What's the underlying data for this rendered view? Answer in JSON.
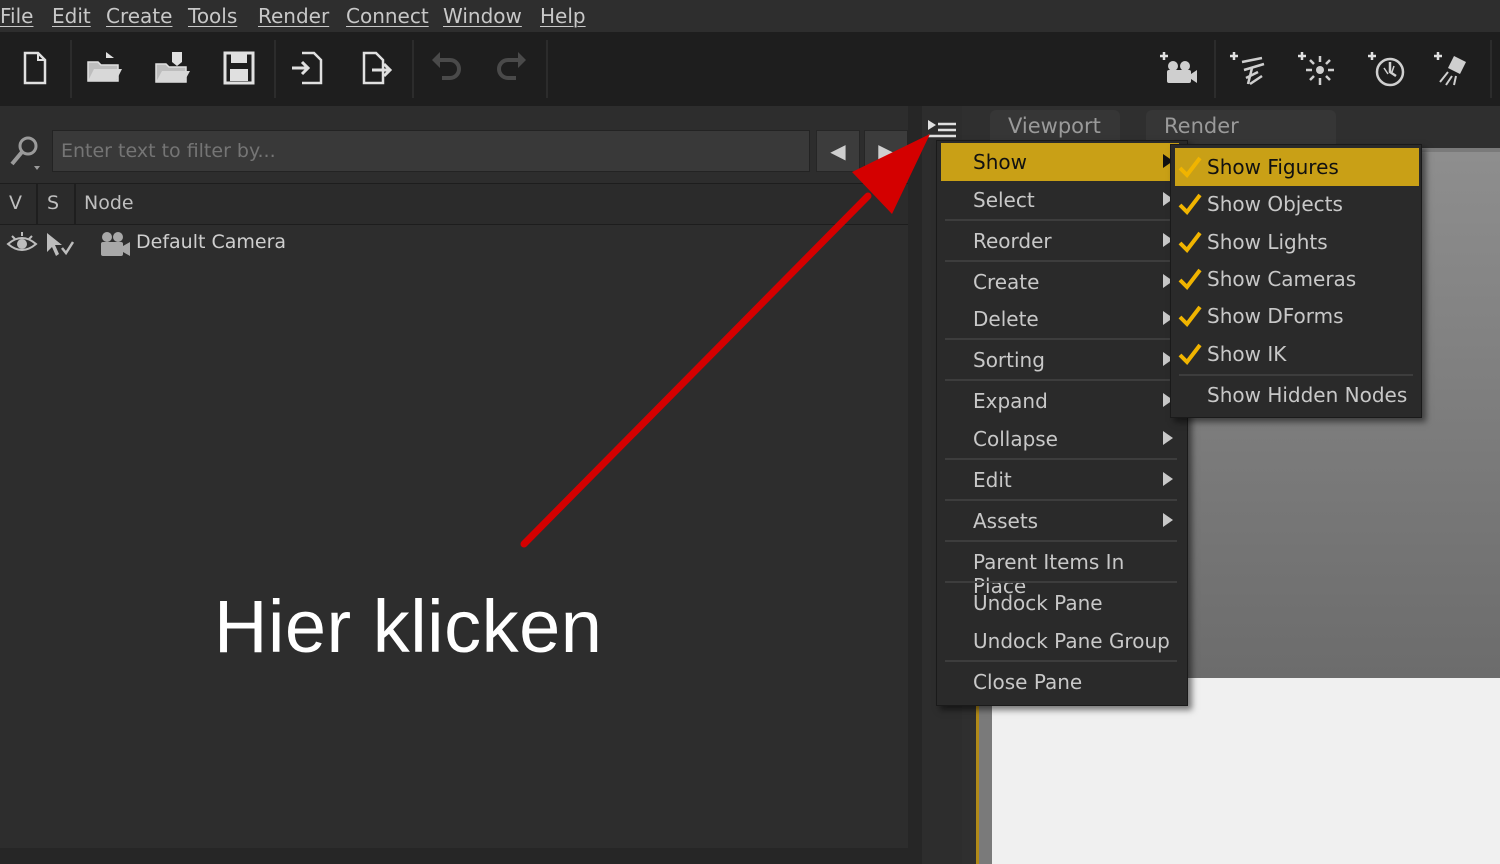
{
  "menubar": {
    "items": [
      "File",
      "Edit",
      "Create",
      "Tools",
      "Render",
      "Connect",
      "Window",
      "Help"
    ]
  },
  "toolbar": {
    "left_icons": [
      "new-file-icon",
      "open-folder-icon",
      "merge-icon",
      "save-icon",
      "import-icon",
      "export-icon",
      "undo-icon",
      "redo-icon"
    ],
    "right_icons": [
      "create-camera-icon",
      "create-distant-light-icon",
      "create-point-light-icon",
      "create-spot-light-icon",
      "create-linear-light-icon"
    ]
  },
  "scene": {
    "filter_placeholder": "Enter text to filter by...",
    "columns": {
      "v": "V",
      "s": "S",
      "node": "Node"
    },
    "rows": [
      {
        "label": "Default Camera"
      }
    ]
  },
  "tabs": [
    "Viewport",
    "Render Library"
  ],
  "context_menu": {
    "items": [
      "Show",
      "Select",
      "Reorder",
      "Create",
      "Delete",
      "Sorting",
      "Expand",
      "Collapse",
      "Edit",
      "Assets",
      "Parent Items In Place",
      "Undock Pane",
      "Undock Pane Group",
      "Close Pane"
    ],
    "highlighted": "Show"
  },
  "show_submenu": {
    "items": [
      "Show Figures",
      "Show Objects",
      "Show Lights",
      "Show Cameras",
      "Show DForms",
      "Show IK",
      "Show Hidden Nodes"
    ],
    "checked": [
      true,
      true,
      true,
      true,
      true,
      true,
      false
    ],
    "highlighted": "Show Figures"
  },
  "annotation": {
    "text": "Hier klicken",
    "arrow_color": "#d40000"
  },
  "colors": {
    "accent": "#c9a016",
    "background": "#2d2d2d",
    "toolbar": "#1e1e1e"
  }
}
